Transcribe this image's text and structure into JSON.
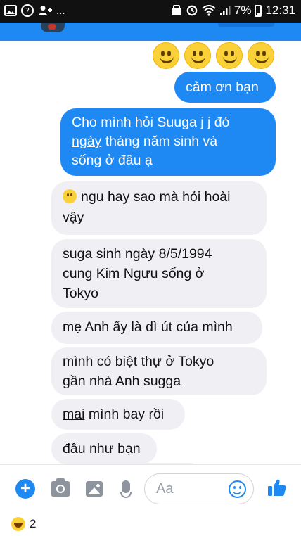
{
  "status_bar": {
    "left_notification": "...",
    "battery_percent": "7%",
    "time": "12:31"
  },
  "messages": [
    {
      "sender": "me",
      "text": "cảm ơn bạn"
    },
    {
      "sender": "me",
      "lines": [
        "Cho mình hỏi Suuga j j đó",
        "ngày",
        "tháng năm sinh  và",
        "sống ở đâu ạ"
      ]
    },
    {
      "sender": "other",
      "lines": [
        "ngu hay sao mà hỏi hoài",
        "vậy"
      ]
    },
    {
      "sender": "other",
      "lines": [
        "suga sinh ngày 8/5/1994",
        "cung Kim Ngưu sống ở",
        "Tokyo"
      ]
    },
    {
      "sender": "other",
      "text": "mẹ Anh ấy là dì út của mình"
    },
    {
      "sender": "other",
      "lines": [
        "mình có biệt thự ở Tokyo",
        "gần nhà Anh sugga"
      ]
    },
    {
      "sender": "other",
      "lines": [
        "mai",
        "mình bay rồi"
      ]
    },
    {
      "sender": "other",
      "text": "đâu như bạn"
    }
  ],
  "composer": {
    "placeholder": "Aa"
  },
  "reactions": {
    "count": "2"
  },
  "colors": {
    "accent": "#1e88f3",
    "incoming_bubble": "#f0eff4",
    "icon_gray": "#8d949e"
  },
  "icons": [
    "notification-image-icon",
    "help-icon",
    "add-person-icon",
    "alarm-icon",
    "wifi-icon",
    "signal-icon",
    "battery-icon",
    "smiley-emoji-icon",
    "plus-icon",
    "camera-icon",
    "gallery-icon",
    "microphone-icon",
    "emoji-picker-icon",
    "thumbs-up-icon",
    "laughing-emoji-icon"
  ]
}
